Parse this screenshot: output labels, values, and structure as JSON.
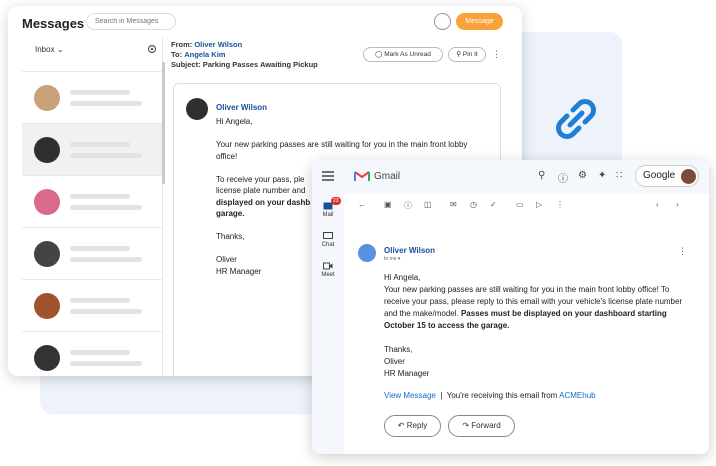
{
  "messages": {
    "title": "Messages",
    "search_placeholder": "Search in Messages",
    "action_button": "Message",
    "folder": "Inbox",
    "from_label": "From:",
    "from_name": "Oliver Wilson",
    "to_label": "To:",
    "to_name": "Angela Kim",
    "subject_label": "Subject:",
    "subject": "Parking Passes Awaiting Pickup",
    "mark_unread": "Mark As Unread",
    "pin": "Pin It",
    "sender": "Oliver Wilson",
    "body": {
      "greeting": "Hi Angela,",
      "p1": "Your new parking passes are still waiting for you in the main front lobby office!",
      "p2_plain": "To receive your pass, ple",
      "p2_plain2": "license plate number and",
      "p2_bold": "displayed on your dashb",
      "p2_bold2": "garage.",
      "thanks": "Thanks,",
      "sig_name": "Oliver",
      "sig_title": "HR Manager"
    },
    "avatars": [
      "#c9a27a",
      "#2f2f2f",
      "#d96b8a",
      "#444444",
      "#a0522d",
      "#333333"
    ]
  },
  "gmail": {
    "app_name": "Gmail",
    "account_label": "Google",
    "nav": {
      "mail": "Mail",
      "chat": "Chat",
      "meet": "Meet",
      "mail_badge": "23"
    },
    "sender": "Oliver Wilson",
    "to_line": "to me",
    "greeting": "Hi Angela,",
    "body_plain": "Your new parking passes are still waiting for you in the main front lobby office! To receive your pass, please reply to this email with your vehicle's license plate number and the make/model.",
    "body_bold": "Passes must be displayed on your dashboard starting October 15 to access the garage.",
    "thanks": "Thanks,",
    "sig_name": "Oliver",
    "sig_title": "HR Manager",
    "view_message": "View Message",
    "separator": "|",
    "receiving_text": "You're receiving this email from",
    "receiving_org": "ACMEhub",
    "reply": "Reply",
    "forward": "Forward"
  },
  "colors": {
    "accent": "#f7a23b",
    "link": "#1a4f9c",
    "bg": "#eef3fb"
  }
}
